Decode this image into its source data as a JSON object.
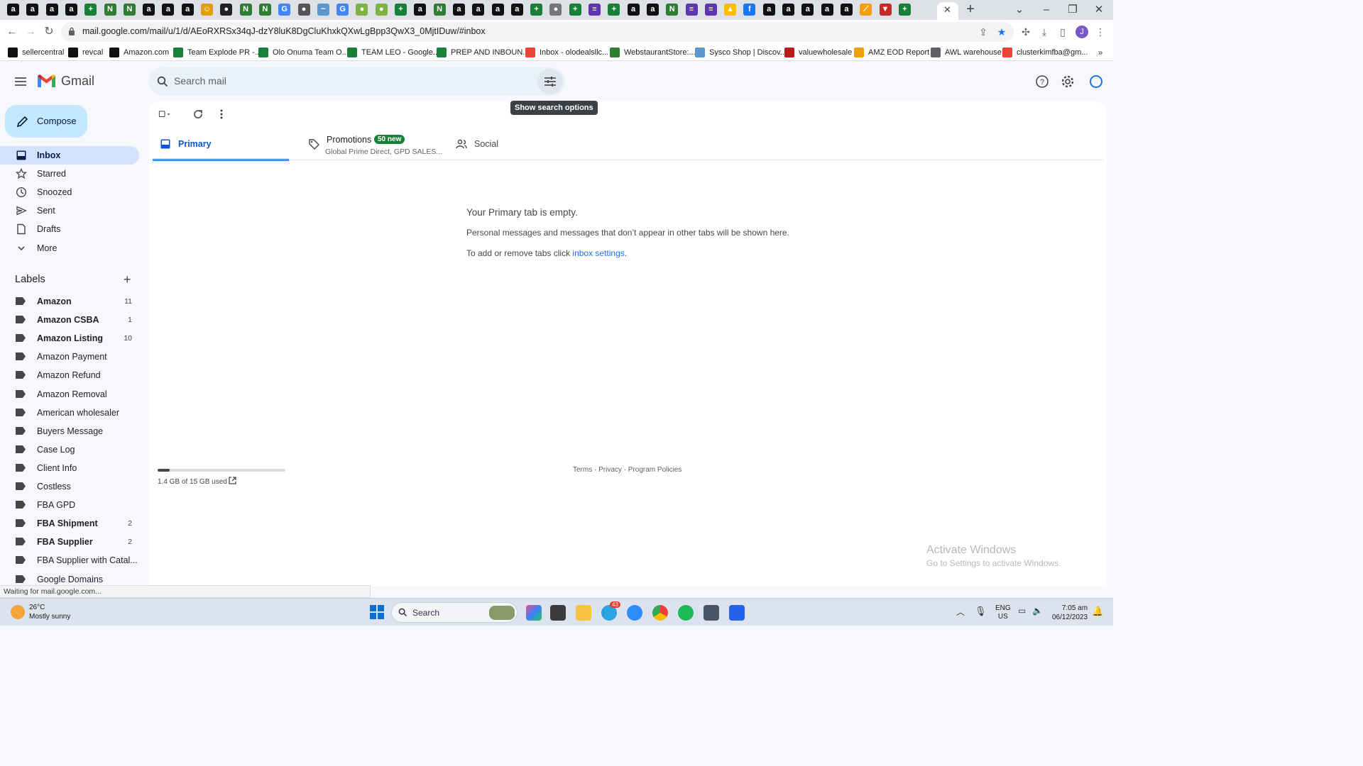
{
  "browser": {
    "url": "mail.google.com/mail/u/1/d/AEoRXRSx34qJ-dzY8luK8DgCluKhxkQXwLgBpp3QwX3_0MjtIDuw/#inbox",
    "profile_initial": "J",
    "tab_fav_letters": [
      "a",
      "a",
      "a",
      "a",
      "+",
      "N",
      "N",
      "a",
      "a",
      "a",
      "☺",
      "●",
      "N",
      "N",
      "G",
      "●",
      "~",
      "G",
      "●",
      "●",
      "+",
      "a",
      "N",
      "a",
      "a",
      "a",
      "a",
      "+",
      "●",
      "+",
      "≡",
      "+",
      "a",
      "a",
      "N",
      "≡",
      "≡",
      "▲",
      "f",
      "a",
      "a",
      "a",
      "a",
      "a",
      "⟋",
      "▼",
      "+"
    ],
    "bookmarks": [
      {
        "label": "sellercentral",
        "icon": "amazon-icon"
      },
      {
        "label": "revcal",
        "icon": "amazon-icon"
      },
      {
        "label": "Amazon.com",
        "icon": "amazon-icon"
      },
      {
        "label": "Team Explode PR -...",
        "icon": "sheets-icon"
      },
      {
        "label": "Olo Onuma Team O...",
        "icon": "sheets-icon"
      },
      {
        "label": "TEAM LEO - Google...",
        "icon": "sheets-icon"
      },
      {
        "label": "PREP AND INBOUN...",
        "icon": "sheets-icon"
      },
      {
        "label": "Inbox - olodealsllc...",
        "icon": "gmail-icon"
      },
      {
        "label": "WebstaurantStore:...",
        "icon": "webstaurant-icon"
      },
      {
        "label": "Sysco Shop | Discov...",
        "icon": "sysco-icon"
      },
      {
        "label": "valuewholesale",
        "icon": "w-icon"
      },
      {
        "label": "AMZ EOD Report",
        "icon": "report-icon"
      },
      {
        "label": "AWL warehouse",
        "icon": "globe-icon"
      },
      {
        "label": "clusterkimfba@gm...",
        "icon": "gmail-icon"
      }
    ]
  },
  "gmail": {
    "brand": "Gmail",
    "search_placeholder": "Search mail",
    "tooltip": "Show search options",
    "compose_label": "Compose",
    "nav": [
      {
        "label": "Inbox",
        "icon": "inbox-icon",
        "active": true
      },
      {
        "label": "Starred",
        "icon": "star-icon"
      },
      {
        "label": "Snoozed",
        "icon": "clock-icon"
      },
      {
        "label": "Sent",
        "icon": "send-icon"
      },
      {
        "label": "Drafts",
        "icon": "draft-icon"
      },
      {
        "label": "More",
        "icon": "chevron-down-icon"
      }
    ],
    "labels_title": "Labels",
    "labels": [
      {
        "label": "Amazon",
        "count": "11",
        "bold": true
      },
      {
        "label": "Amazon CSBA",
        "count": "1",
        "bold": true
      },
      {
        "label": "Amazon Listing",
        "count": "10",
        "bold": true
      },
      {
        "label": "Amazon Payment",
        "count": "",
        "bold": false
      },
      {
        "label": "Amazon Refund",
        "count": "",
        "bold": false
      },
      {
        "label": "Amazon Removal",
        "count": "",
        "bold": false
      },
      {
        "label": "American wholesaler",
        "count": "",
        "bold": false
      },
      {
        "label": "Buyers Message",
        "count": "",
        "bold": false
      },
      {
        "label": "Case Log",
        "count": "",
        "bold": false
      },
      {
        "label": "Client Info",
        "count": "",
        "bold": false
      },
      {
        "label": "Costless",
        "count": "",
        "bold": false
      },
      {
        "label": "FBA GPD",
        "count": "",
        "bold": false
      },
      {
        "label": "FBA Shipment",
        "count": "2",
        "bold": true
      },
      {
        "label": "FBA Supplier",
        "count": "2",
        "bold": true
      },
      {
        "label": "FBA Supplier with Catal...",
        "count": "",
        "bold": false
      },
      {
        "label": "Google Domains",
        "count": "",
        "bold": false
      }
    ],
    "tabs": {
      "primary": "Primary",
      "promotions": "Promotions",
      "promotions_badge": "50 new",
      "promotions_sub": "Global Prime Direct, GPD SALES...",
      "social": "Social"
    },
    "empty": {
      "title": "Your Primary tab is empty.",
      "description": "Personal messages and messages that don’t appear in other tabs will be shown here.",
      "settings_prefix": "To add or remove tabs click ",
      "settings_link": "inbox settings",
      "settings_suffix": "."
    },
    "storage": {
      "text": "1.4 GB of 15 GB used",
      "used_fraction": 0.093
    },
    "footer": "Terms · Privacy · Program Policies",
    "status": "Waiting for mail.google.com..."
  },
  "windows": {
    "activate_title": "Activate Windows",
    "activate_sub": "Go to Settings to activate Windows.",
    "weather_temp": "26°C",
    "weather_desc": "Mostly sunny",
    "search_label": "Search",
    "telegram_badge": "43",
    "lang_top": "ENG",
    "lang_bottom": "US",
    "time": "7:05 am",
    "date": "06/12/2023"
  },
  "colors": {
    "accent": "#0b57d0",
    "compose": "#c2e7ff",
    "active_nav": "#d3e3fd",
    "promo_badge": "#188038"
  }
}
